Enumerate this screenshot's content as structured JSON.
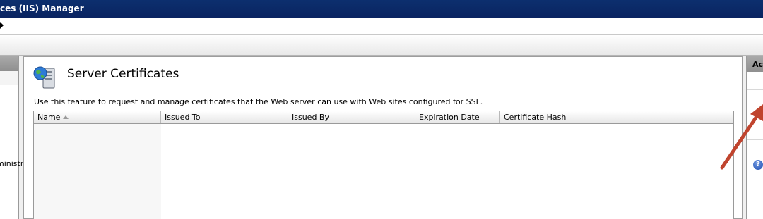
{
  "window": {
    "title": "ces (IIS) Manager"
  },
  "left_pane": {
    "tree_partial_label": "ministr"
  },
  "feature": {
    "title": "Server Certificates",
    "description": "Use this feature to request and manage certificates that the Web server can use with Web sites configured for SSL.",
    "icon": "server-certificates-icon"
  },
  "table": {
    "columns": [
      "Name",
      "Issued To",
      "Issued By",
      "Expiration Date",
      "Certificate Hash"
    ],
    "sort_column": "Name",
    "sort_direction": "ascending",
    "rows": []
  },
  "actions_pane": {
    "header_partial": "Ac",
    "help_icon": "help-icon"
  },
  "colors": {
    "title_bar": "#0a2461",
    "annotation_arrow": "#c0442e"
  }
}
